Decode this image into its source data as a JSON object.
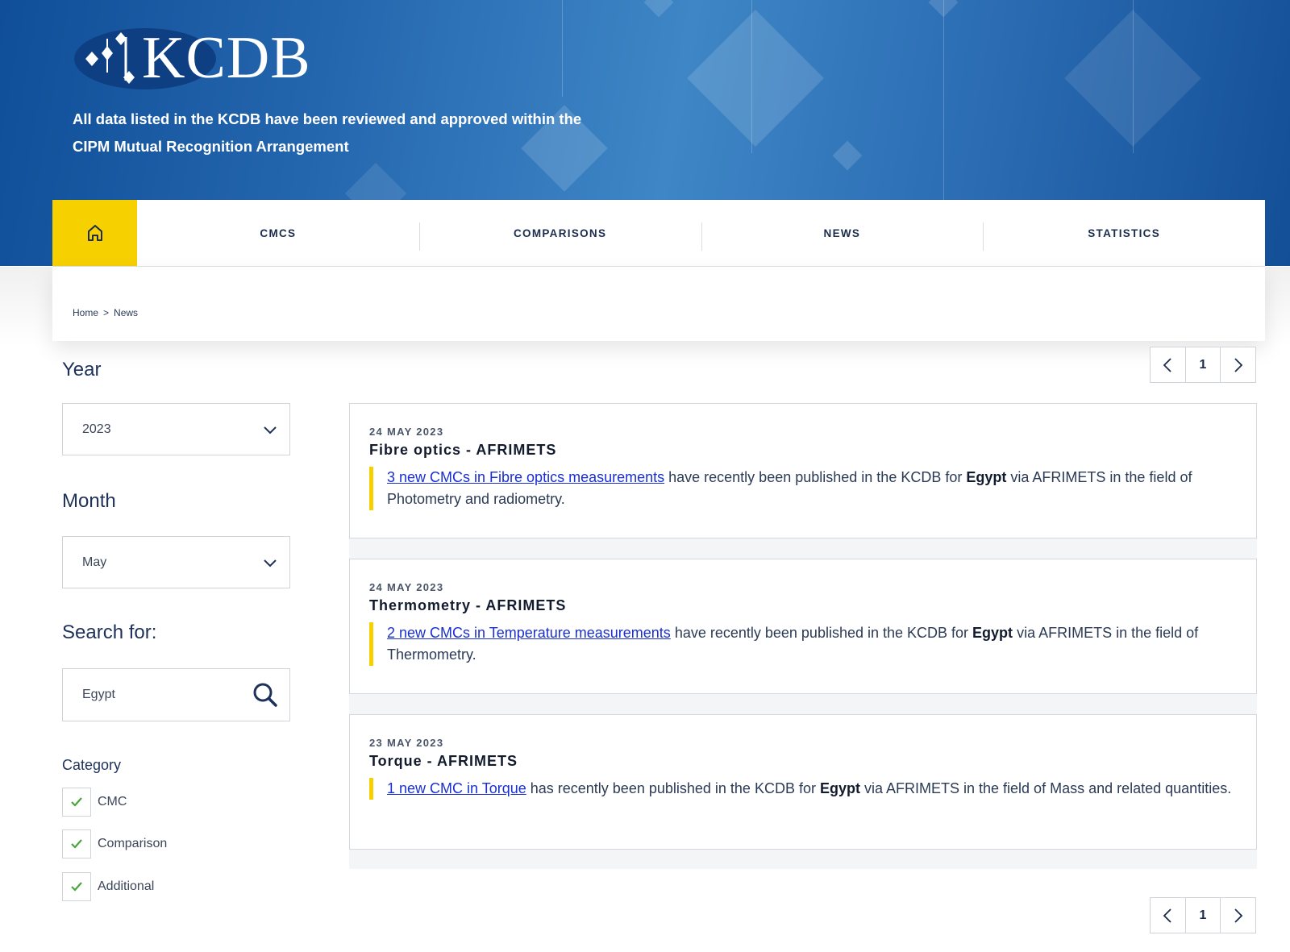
{
  "header": {
    "logo_text": "KCDB",
    "tagline_line1": "All data listed in the KCDB have been reviewed and approved within the",
    "tagline_line2": "CIPM Mutual Recognition Arrangement"
  },
  "nav": {
    "home_icon": "home-icon",
    "items": [
      {
        "label": "CMCS"
      },
      {
        "label": "COMPARISONS"
      },
      {
        "label": "NEWS"
      },
      {
        "label": "STATISTICS"
      }
    ]
  },
  "breadcrumb": {
    "home": "Home",
    "separator": ">",
    "current": "News"
  },
  "filters": {
    "year_label": "Year",
    "year_value": "2023",
    "month_label": "Month",
    "month_value": "May",
    "search_label": "Search for:",
    "search_value": "Egypt",
    "category_label": "Category",
    "categories": [
      {
        "label": "CMC",
        "checked": true
      },
      {
        "label": "Comparison",
        "checked": true
      },
      {
        "label": "Additional",
        "checked": true
      }
    ]
  },
  "pagination": {
    "current_page": "1",
    "prev_icon": "chevron-left-icon",
    "next_icon": "chevron-right-icon"
  },
  "news": [
    {
      "date": "24  MAY 2023",
      "title": "Fibre optics - AFRIMETS",
      "link_text": "3 new CMCs in Fibre optics measurements",
      "body_a": " have recently been published in the KCDB for ",
      "country": "Egypt",
      "body_b": " via AFRIMETS in the field of Photometry and radiometry."
    },
    {
      "date": "24  MAY 2023",
      "title": "Thermometry - AFRIMETS",
      "link_text": "2 new CMCs in Temperature measurements",
      "body_a": " have recently been published in the KCDB for ",
      "country": "Egypt",
      "body_b": " via AFRIMETS in the field of Thermometry."
    },
    {
      "date": "23  MAY 2023",
      "title": "Torque - AFRIMETS",
      "link_text": "1 new CMC in Torque",
      "body_a": " has recently been published in the KCDB for ",
      "country": "Egypt",
      "body_b": " via AFRIMETS in the field of Mass and related quantities."
    }
  ],
  "colors": {
    "brand_blue": "#1d5ea8",
    "accent_yellow": "#f7d000",
    "link": "#1a2fd1",
    "check_green": "#4aa63c"
  }
}
